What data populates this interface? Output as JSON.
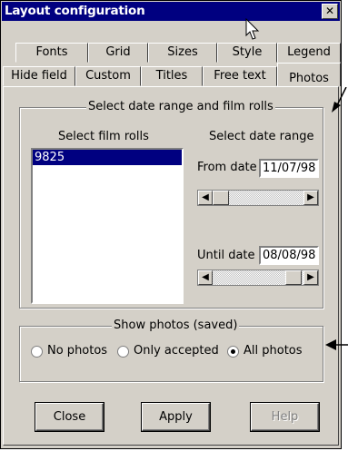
{
  "window": {
    "title": "Layout configuration",
    "close_glyph": "✕"
  },
  "tabs_row1": [
    "Fonts",
    "Grid",
    "Sizes",
    "Style",
    "Legend"
  ],
  "tabs_row2": [
    "Hide field",
    "Custom",
    "Titles",
    "Free text",
    "Photos"
  ],
  "active_tab": "Photos",
  "date_film_group": {
    "legend": "Select date range and film rolls",
    "film_rolls_label": "Select film rolls",
    "film_rolls": [
      {
        "value": "9825",
        "selected": true
      }
    ],
    "date_range_label": "Select date range",
    "from_label": "From date",
    "from_value": "11/07/98",
    "until_label": "Until date",
    "until_value": "08/08/98"
  },
  "photos_group": {
    "legend": "Show photos (saved)",
    "options": [
      {
        "label": "No photos",
        "checked": false
      },
      {
        "label": "Only accepted",
        "checked": false
      },
      {
        "label": "All photos",
        "checked": true
      }
    ]
  },
  "buttons": {
    "close": "Close",
    "apply": "Apply",
    "help": "Help",
    "help_enabled": false
  },
  "icons": {
    "scroll_left": "◀",
    "scroll_right": "▶",
    "annotation_arrow": "arrow-pointer-icon",
    "cursor": "mouse-cursor-icon"
  }
}
